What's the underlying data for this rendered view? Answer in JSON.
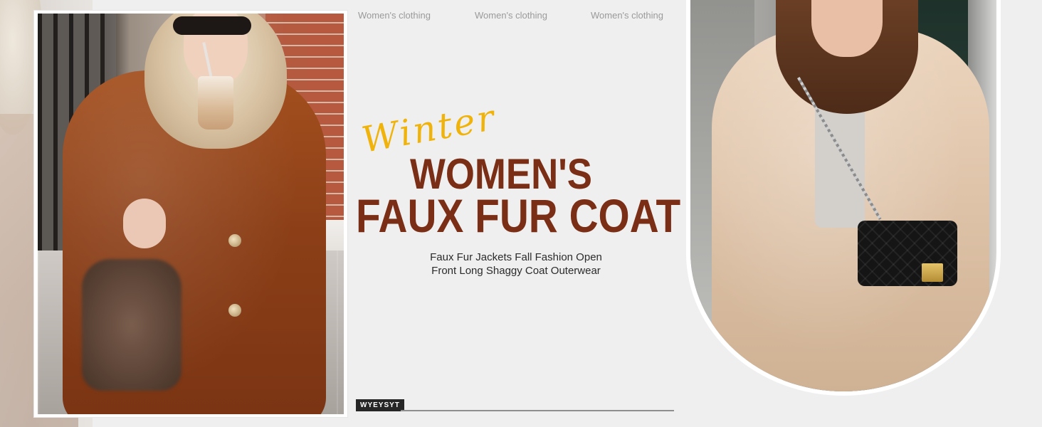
{
  "captions": [
    "Women's clothing",
    "Women's clothing",
    "Women's clothing"
  ],
  "headline": {
    "script_word": "Winter",
    "line1": "WOMEN'S",
    "line2": "FAUX FUR COAT"
  },
  "subtitle": {
    "line1": "Faux Fur Jackets Fall Fashion Open",
    "line2": "Front Long Shaggy Coat Outerwear"
  },
  "brand": "WYEYSYT",
  "colors": {
    "background": "#efefef",
    "headline": "#7b2e16",
    "script_accent": "#efb30c",
    "brand_tag": "#262626"
  }
}
